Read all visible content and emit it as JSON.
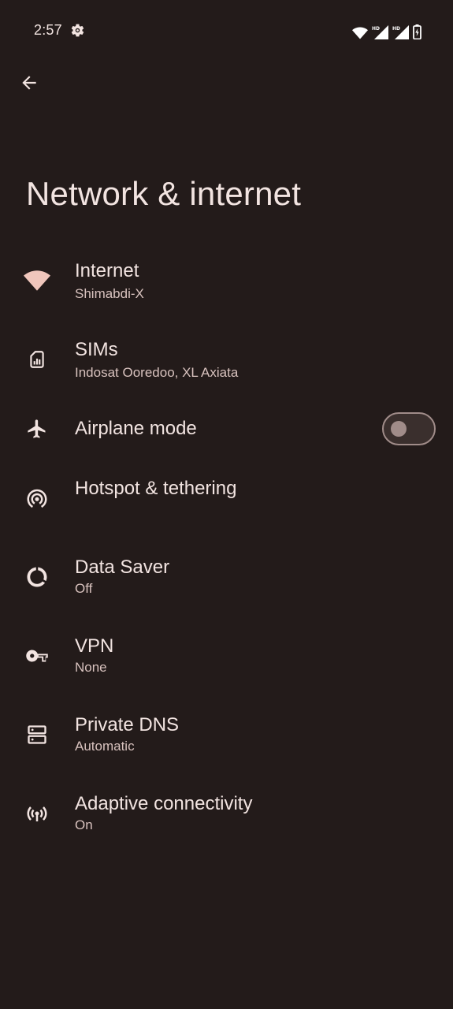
{
  "status_bar": {
    "time": "2:57",
    "icons": [
      "gear-icon",
      "wifi-icon",
      "hd-signal-icon",
      "hd-signal-icon",
      "battery-charging-icon"
    ]
  },
  "header": {
    "back_icon": "back-arrow-icon",
    "title": "Network & internet"
  },
  "settings": [
    {
      "id": "internet",
      "icon": "wifi-icon",
      "title": "Internet",
      "summary": "Shimabdi-X"
    },
    {
      "id": "sims",
      "icon": "sim-card-icon",
      "title": "SIMs",
      "summary": "Indosat Ooredoo, XL Axiata"
    },
    {
      "id": "airplane",
      "icon": "airplane-icon",
      "title": "Airplane mode",
      "summary": "",
      "toggle": "off"
    },
    {
      "id": "hotspot",
      "icon": "hotspot-icon",
      "title": "Hotspot & tethering",
      "summary": ""
    },
    {
      "id": "data-saver",
      "icon": "data-saver-icon",
      "title": "Data Saver",
      "summary": "Off"
    },
    {
      "id": "vpn",
      "icon": "vpn-key-icon",
      "title": "VPN",
      "summary": "None"
    },
    {
      "id": "private-dns",
      "icon": "dns-icon",
      "title": "Private DNS",
      "summary": "Automatic"
    },
    {
      "id": "adaptive",
      "icon": "adaptive-connectivity-icon",
      "title": "Adaptive connectivity",
      "summary": "On"
    }
  ],
  "colors": {
    "background": "#231b1a",
    "text_primary": "#f2e4e1",
    "text_secondary": "#d8c2be",
    "toggle_off": "#a08c89"
  }
}
